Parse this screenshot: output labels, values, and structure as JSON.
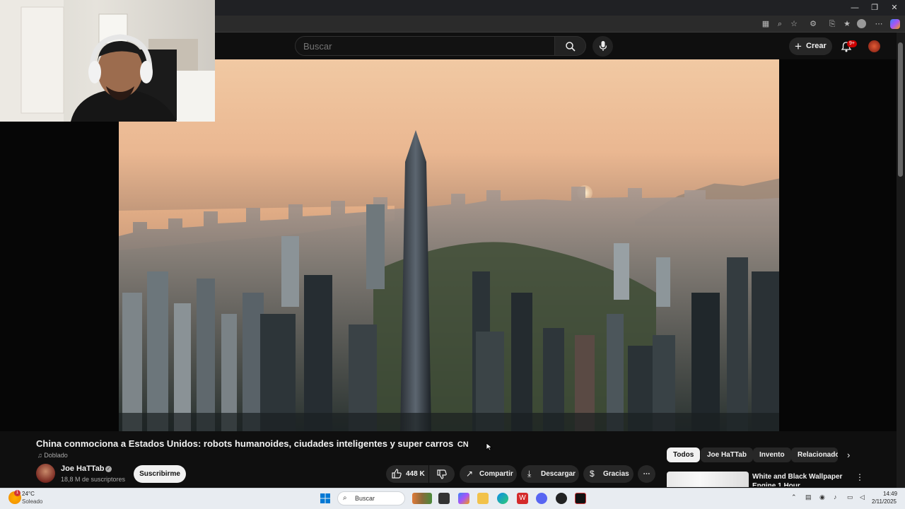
{
  "browser": {
    "window_controls": {
      "minimize": "—",
      "restore": "❐",
      "close": "✕"
    }
  },
  "youtube": {
    "search": {
      "placeholder": "Buscar"
    },
    "create_label": "Crear",
    "notifications_badge": "9+"
  },
  "video": {
    "title": "China conmociona a Estados Unidos: robots humanoides, ciudades inteligentes y super carros",
    "title_flag": "CN",
    "dubbed_label": "Doblado",
    "channel": {
      "name": "Joe HaTTab",
      "subscribers": "18,8 M de suscriptores"
    },
    "subscribe_label": "Suscribirme",
    "actions": {
      "likes": "448 K",
      "share": "Compartir",
      "download": "Descargar",
      "thanks": "Gracias"
    }
  },
  "sidebar": {
    "chips": [
      "Todos",
      "Joe HaTTab",
      "Invento",
      "Relacionado"
    ],
    "active_chip": "Todos",
    "recommendation": {
      "title": "White and Black Wallpaper Engine 1 Hour"
    }
  },
  "taskbar": {
    "weather": {
      "temp": "24°C",
      "desc": "Soleado",
      "alert": "1"
    },
    "search_placeholder": "Buscar",
    "time": "14:49",
    "date": "2/11/2025"
  },
  "colors": {
    "youtube_bg": "#0f0f0f",
    "notification_badge": "#cc0000",
    "taskbar_bg": "#e8ecf1"
  }
}
